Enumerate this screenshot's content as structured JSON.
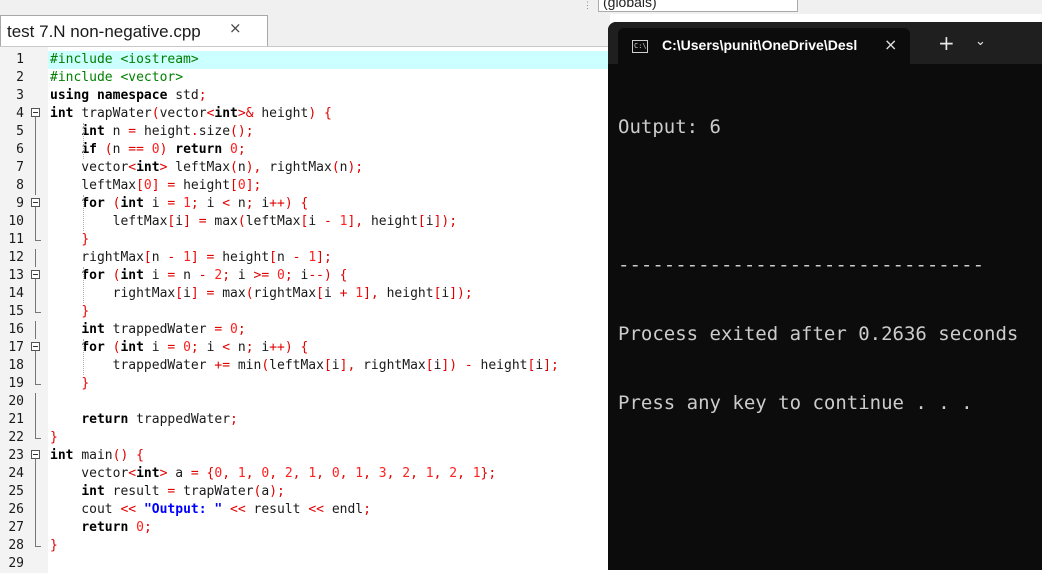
{
  "editor": {
    "scope_label": "(globals)",
    "tab_title": "test 7.N non-negative.cpp",
    "tab_close": "×",
    "lines": [
      {
        "n": "1",
        "fold": "",
        "tokens": [
          [
            "pp",
            "#include <iostream>"
          ]
        ]
      },
      {
        "n": "2",
        "fold": "",
        "tokens": [
          [
            "pp",
            "#include <vector>"
          ]
        ]
      },
      {
        "n": "3",
        "fold": "",
        "tokens": [
          [
            "kw",
            "using namespace "
          ],
          [
            "t",
            "std"
          ],
          [
            "op",
            ";"
          ]
        ]
      },
      {
        "n": "4",
        "fold": "box",
        "tokens": [
          [
            "kw",
            "int "
          ],
          [
            "t",
            "trapWater"
          ],
          [
            "op",
            "("
          ],
          [
            "t",
            "vector"
          ],
          [
            "op",
            "<"
          ],
          [
            "kw",
            "int"
          ],
          [
            "op",
            ">& "
          ],
          [
            "t",
            "height"
          ],
          [
            "op",
            ") {"
          ]
        ]
      },
      {
        "n": "5",
        "fold": "line",
        "tokens": [
          [
            "t",
            "    "
          ],
          [
            "kw",
            "int "
          ],
          [
            "t",
            "n "
          ],
          [
            "op",
            "= "
          ],
          [
            "t",
            "height"
          ],
          [
            "op",
            "."
          ],
          [
            "t",
            "size"
          ],
          [
            "op",
            "();"
          ]
        ]
      },
      {
        "n": "6",
        "fold": "line",
        "tokens": [
          [
            "t",
            "    "
          ],
          [
            "kw",
            "if "
          ],
          [
            "op",
            "("
          ],
          [
            "t",
            "n "
          ],
          [
            "op",
            "== "
          ],
          [
            "num",
            "0"
          ],
          [
            "op",
            ") "
          ],
          [
            "kw",
            "return "
          ],
          [
            "num",
            "0"
          ],
          [
            "op",
            ";"
          ]
        ]
      },
      {
        "n": "7",
        "fold": "line",
        "tokens": [
          [
            "t",
            "    vector"
          ],
          [
            "op",
            "<"
          ],
          [
            "kw",
            "int"
          ],
          [
            "op",
            "> "
          ],
          [
            "t",
            "leftMax"
          ],
          [
            "op",
            "("
          ],
          [
            "t",
            "n"
          ],
          [
            "op",
            "), "
          ],
          [
            "t",
            "rightMax"
          ],
          [
            "op",
            "("
          ],
          [
            "t",
            "n"
          ],
          [
            "op",
            ");"
          ]
        ]
      },
      {
        "n": "8",
        "fold": "line",
        "tokens": [
          [
            "t",
            "    leftMax"
          ],
          [
            "op",
            "["
          ],
          [
            "num",
            "0"
          ],
          [
            "op",
            "] = "
          ],
          [
            "t",
            "height"
          ],
          [
            "op",
            "["
          ],
          [
            "num",
            "0"
          ],
          [
            "op",
            "];"
          ]
        ]
      },
      {
        "n": "9",
        "fold": "box",
        "tokens": [
          [
            "t",
            "    "
          ],
          [
            "kw",
            "for "
          ],
          [
            "op",
            "("
          ],
          [
            "kw",
            "int "
          ],
          [
            "t",
            "i "
          ],
          [
            "op",
            "= "
          ],
          [
            "num",
            "1"
          ],
          [
            "op",
            "; "
          ],
          [
            "t",
            "i "
          ],
          [
            "op",
            "< "
          ],
          [
            "t",
            "n"
          ],
          [
            "op",
            "; "
          ],
          [
            "t",
            "i"
          ],
          [
            "op",
            "++) {"
          ]
        ]
      },
      {
        "n": "10",
        "fold": "line",
        "tokens": [
          [
            "t",
            "        leftMax"
          ],
          [
            "op",
            "["
          ],
          [
            "t",
            "i"
          ],
          [
            "op",
            "] = "
          ],
          [
            "t",
            "max"
          ],
          [
            "op",
            "("
          ],
          [
            "t",
            "leftMax"
          ],
          [
            "op",
            "["
          ],
          [
            "t",
            "i "
          ],
          [
            "op",
            "- "
          ],
          [
            "num",
            "1"
          ],
          [
            "op",
            "], "
          ],
          [
            "t",
            "height"
          ],
          [
            "op",
            "["
          ],
          [
            "t",
            "i"
          ],
          [
            "op",
            "]);"
          ]
        ]
      },
      {
        "n": "11",
        "fold": "end",
        "tokens": [
          [
            "t",
            "    "
          ],
          [
            "op",
            "}"
          ]
        ]
      },
      {
        "n": "12",
        "fold": "line",
        "tokens": [
          [
            "t",
            "    rightMax"
          ],
          [
            "op",
            "["
          ],
          [
            "t",
            "n "
          ],
          [
            "op",
            "- "
          ],
          [
            "num",
            "1"
          ],
          [
            "op",
            "] = "
          ],
          [
            "t",
            "height"
          ],
          [
            "op",
            "["
          ],
          [
            "t",
            "n "
          ],
          [
            "op",
            "- "
          ],
          [
            "num",
            "1"
          ],
          [
            "op",
            "];"
          ]
        ]
      },
      {
        "n": "13",
        "fold": "box",
        "tokens": [
          [
            "t",
            "    "
          ],
          [
            "kw",
            "for "
          ],
          [
            "op",
            "("
          ],
          [
            "kw",
            "int "
          ],
          [
            "t",
            "i "
          ],
          [
            "op",
            "= "
          ],
          [
            "t",
            "n "
          ],
          [
            "op",
            "- "
          ],
          [
            "num",
            "2"
          ],
          [
            "op",
            "; "
          ],
          [
            "t",
            "i "
          ],
          [
            "op",
            ">= "
          ],
          [
            "num",
            "0"
          ],
          [
            "op",
            "; "
          ],
          [
            "t",
            "i"
          ],
          [
            "op",
            "--) {"
          ]
        ]
      },
      {
        "n": "14",
        "fold": "line",
        "tokens": [
          [
            "t",
            "        rightMax"
          ],
          [
            "op",
            "["
          ],
          [
            "t",
            "i"
          ],
          [
            "op",
            "] = "
          ],
          [
            "t",
            "max"
          ],
          [
            "op",
            "("
          ],
          [
            "t",
            "rightMax"
          ],
          [
            "op",
            "["
          ],
          [
            "t",
            "i "
          ],
          [
            "op",
            "+ "
          ],
          [
            "num",
            "1"
          ],
          [
            "op",
            "], "
          ],
          [
            "t",
            "height"
          ],
          [
            "op",
            "["
          ],
          [
            "t",
            "i"
          ],
          [
            "op",
            "]);"
          ]
        ]
      },
      {
        "n": "15",
        "fold": "end",
        "tokens": [
          [
            "t",
            "    "
          ],
          [
            "op",
            "}"
          ]
        ]
      },
      {
        "n": "16",
        "fold": "line",
        "tokens": [
          [
            "t",
            "    "
          ],
          [
            "kw",
            "int "
          ],
          [
            "t",
            "trappedWater "
          ],
          [
            "op",
            "= "
          ],
          [
            "num",
            "0"
          ],
          [
            "op",
            ";"
          ]
        ]
      },
      {
        "n": "17",
        "fold": "box",
        "tokens": [
          [
            "t",
            "    "
          ],
          [
            "kw",
            "for "
          ],
          [
            "op",
            "("
          ],
          [
            "kw",
            "int "
          ],
          [
            "t",
            "i "
          ],
          [
            "op",
            "= "
          ],
          [
            "num",
            "0"
          ],
          [
            "op",
            "; "
          ],
          [
            "t",
            "i "
          ],
          [
            "op",
            "< "
          ],
          [
            "t",
            "n"
          ],
          [
            "op",
            "; "
          ],
          [
            "t",
            "i"
          ],
          [
            "op",
            "++) {"
          ]
        ]
      },
      {
        "n": "18",
        "fold": "line",
        "tokens": [
          [
            "t",
            "        trappedWater "
          ],
          [
            "op",
            "+= "
          ],
          [
            "t",
            "min"
          ],
          [
            "op",
            "("
          ],
          [
            "t",
            "leftMax"
          ],
          [
            "op",
            "["
          ],
          [
            "t",
            "i"
          ],
          [
            "op",
            "], "
          ],
          [
            "t",
            "rightMax"
          ],
          [
            "op",
            "["
          ],
          [
            "t",
            "i"
          ],
          [
            "op",
            "]) - "
          ],
          [
            "t",
            "height"
          ],
          [
            "op",
            "["
          ],
          [
            "t",
            "i"
          ],
          [
            "op",
            "];"
          ]
        ]
      },
      {
        "n": "19",
        "fold": "end",
        "tokens": [
          [
            "t",
            "    "
          ],
          [
            "op",
            "}"
          ]
        ]
      },
      {
        "n": "20",
        "fold": "line",
        "tokens": []
      },
      {
        "n": "21",
        "fold": "line",
        "tokens": [
          [
            "t",
            "    "
          ],
          [
            "kw",
            "return "
          ],
          [
            "t",
            "trappedWater"
          ],
          [
            "op",
            ";"
          ]
        ]
      },
      {
        "n": "22",
        "fold": "end",
        "tokens": [
          [
            "op",
            "}"
          ]
        ]
      },
      {
        "n": "23",
        "fold": "box",
        "tokens": [
          [
            "kw",
            "int "
          ],
          [
            "t",
            "main"
          ],
          [
            "op",
            "() {"
          ]
        ]
      },
      {
        "n": "24",
        "fold": "line",
        "tokens": [
          [
            "t",
            "    vector"
          ],
          [
            "op",
            "<"
          ],
          [
            "kw",
            "int"
          ],
          [
            "op",
            "> "
          ],
          [
            "t",
            "a "
          ],
          [
            "op",
            "= {"
          ],
          [
            "num",
            "0"
          ],
          [
            "op",
            ", "
          ],
          [
            "num",
            "1"
          ],
          [
            "op",
            ", "
          ],
          [
            "num",
            "0"
          ],
          [
            "op",
            ", "
          ],
          [
            "num",
            "2"
          ],
          [
            "op",
            ", "
          ],
          [
            "num",
            "1"
          ],
          [
            "op",
            ", "
          ],
          [
            "num",
            "0"
          ],
          [
            "op",
            ", "
          ],
          [
            "num",
            "1"
          ],
          [
            "op",
            ", "
          ],
          [
            "num",
            "3"
          ],
          [
            "op",
            ", "
          ],
          [
            "num",
            "2"
          ],
          [
            "op",
            ", "
          ],
          [
            "num",
            "1"
          ],
          [
            "op",
            ", "
          ],
          [
            "num",
            "2"
          ],
          [
            "op",
            ", "
          ],
          [
            "num",
            "1"
          ],
          [
            "op",
            "};"
          ]
        ]
      },
      {
        "n": "25",
        "fold": "line",
        "tokens": [
          [
            "t",
            "    "
          ],
          [
            "kw",
            "int "
          ],
          [
            "t",
            "result "
          ],
          [
            "op",
            "= "
          ],
          [
            "t",
            "trapWater"
          ],
          [
            "op",
            "("
          ],
          [
            "t",
            "a"
          ],
          [
            "op",
            ");"
          ]
        ]
      },
      {
        "n": "26",
        "fold": "line",
        "tokens": [
          [
            "t",
            "    cout "
          ],
          [
            "op",
            "<< "
          ],
          [
            "str",
            "\"Output: \""
          ],
          [
            "op",
            " << "
          ],
          [
            "t",
            "result "
          ],
          [
            "op",
            "<< "
          ],
          [
            "t",
            "endl"
          ],
          [
            "op",
            ";"
          ]
        ]
      },
      {
        "n": "27",
        "fold": "line",
        "tokens": [
          [
            "t",
            "    "
          ],
          [
            "kw",
            "return "
          ],
          [
            "num",
            "0"
          ],
          [
            "op",
            ";"
          ]
        ]
      },
      {
        "n": "28",
        "fold": "end",
        "tokens": [
          [
            "op",
            "}"
          ]
        ]
      },
      {
        "n": "29",
        "fold": "",
        "tokens": []
      }
    ]
  },
  "console": {
    "tab_title": "C:\\Users\\punit\\OneDrive\\Desl",
    "tab_close": "×",
    "new_tab": "+",
    "dropdown": "⌄",
    "icon_text": "C:\\",
    "lines": [
      "Output: 6",
      "",
      "--------------------------------",
      "Process exited after 0.2636 seconds",
      "Press any key to continue . . ."
    ]
  }
}
